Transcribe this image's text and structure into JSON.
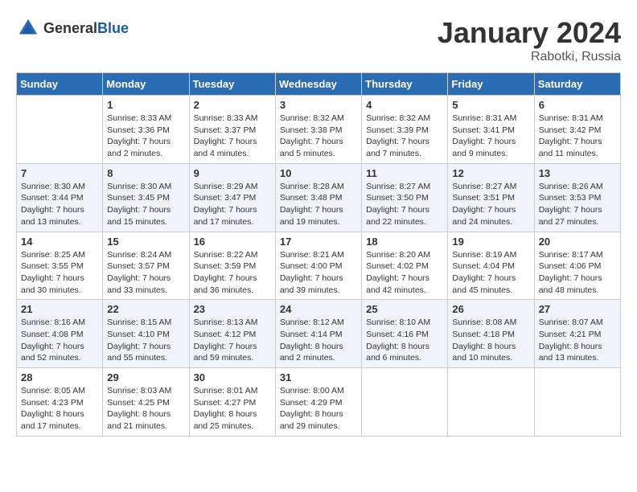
{
  "header": {
    "logo_general": "General",
    "logo_blue": "Blue",
    "month": "January 2024",
    "location": "Rabotki, Russia"
  },
  "columns": [
    "Sunday",
    "Monday",
    "Tuesday",
    "Wednesday",
    "Thursday",
    "Friday",
    "Saturday"
  ],
  "weeks": [
    [
      {
        "day": "",
        "info": ""
      },
      {
        "day": "1",
        "info": "Sunrise: 8:33 AM\nSunset: 3:36 PM\nDaylight: 7 hours\nand 2 minutes."
      },
      {
        "day": "2",
        "info": "Sunrise: 8:33 AM\nSunset: 3:37 PM\nDaylight: 7 hours\nand 4 minutes."
      },
      {
        "day": "3",
        "info": "Sunrise: 8:32 AM\nSunset: 3:38 PM\nDaylight: 7 hours\nand 5 minutes."
      },
      {
        "day": "4",
        "info": "Sunrise: 8:32 AM\nSunset: 3:39 PM\nDaylight: 7 hours\nand 7 minutes."
      },
      {
        "day": "5",
        "info": "Sunrise: 8:31 AM\nSunset: 3:41 PM\nDaylight: 7 hours\nand 9 minutes."
      },
      {
        "day": "6",
        "info": "Sunrise: 8:31 AM\nSunset: 3:42 PM\nDaylight: 7 hours\nand 11 minutes."
      }
    ],
    [
      {
        "day": "7",
        "info": "Sunrise: 8:30 AM\nSunset: 3:44 PM\nDaylight: 7 hours\nand 13 minutes."
      },
      {
        "day": "8",
        "info": "Sunrise: 8:30 AM\nSunset: 3:45 PM\nDaylight: 7 hours\nand 15 minutes."
      },
      {
        "day": "9",
        "info": "Sunrise: 8:29 AM\nSunset: 3:47 PM\nDaylight: 7 hours\nand 17 minutes."
      },
      {
        "day": "10",
        "info": "Sunrise: 8:28 AM\nSunset: 3:48 PM\nDaylight: 7 hours\nand 19 minutes."
      },
      {
        "day": "11",
        "info": "Sunrise: 8:27 AM\nSunset: 3:50 PM\nDaylight: 7 hours\nand 22 minutes."
      },
      {
        "day": "12",
        "info": "Sunrise: 8:27 AM\nSunset: 3:51 PM\nDaylight: 7 hours\nand 24 minutes."
      },
      {
        "day": "13",
        "info": "Sunrise: 8:26 AM\nSunset: 3:53 PM\nDaylight: 7 hours\nand 27 minutes."
      }
    ],
    [
      {
        "day": "14",
        "info": "Sunrise: 8:25 AM\nSunset: 3:55 PM\nDaylight: 7 hours\nand 30 minutes."
      },
      {
        "day": "15",
        "info": "Sunrise: 8:24 AM\nSunset: 3:57 PM\nDaylight: 7 hours\nand 33 minutes."
      },
      {
        "day": "16",
        "info": "Sunrise: 8:22 AM\nSunset: 3:59 PM\nDaylight: 7 hours\nand 36 minutes."
      },
      {
        "day": "17",
        "info": "Sunrise: 8:21 AM\nSunset: 4:00 PM\nDaylight: 7 hours\nand 39 minutes."
      },
      {
        "day": "18",
        "info": "Sunrise: 8:20 AM\nSunset: 4:02 PM\nDaylight: 7 hours\nand 42 minutes."
      },
      {
        "day": "19",
        "info": "Sunrise: 8:19 AM\nSunset: 4:04 PM\nDaylight: 7 hours\nand 45 minutes."
      },
      {
        "day": "20",
        "info": "Sunrise: 8:17 AM\nSunset: 4:06 PM\nDaylight: 7 hours\nand 48 minutes."
      }
    ],
    [
      {
        "day": "21",
        "info": "Sunrise: 8:16 AM\nSunset: 4:08 PM\nDaylight: 7 hours\nand 52 minutes."
      },
      {
        "day": "22",
        "info": "Sunrise: 8:15 AM\nSunset: 4:10 PM\nDaylight: 7 hours\nand 55 minutes."
      },
      {
        "day": "23",
        "info": "Sunrise: 8:13 AM\nSunset: 4:12 PM\nDaylight: 7 hours\nand 59 minutes."
      },
      {
        "day": "24",
        "info": "Sunrise: 8:12 AM\nSunset: 4:14 PM\nDaylight: 8 hours\nand 2 minutes."
      },
      {
        "day": "25",
        "info": "Sunrise: 8:10 AM\nSunset: 4:16 PM\nDaylight: 8 hours\nand 6 minutes."
      },
      {
        "day": "26",
        "info": "Sunrise: 8:08 AM\nSunset: 4:18 PM\nDaylight: 8 hours\nand 10 minutes."
      },
      {
        "day": "27",
        "info": "Sunrise: 8:07 AM\nSunset: 4:21 PM\nDaylight: 8 hours\nand 13 minutes."
      }
    ],
    [
      {
        "day": "28",
        "info": "Sunrise: 8:05 AM\nSunset: 4:23 PM\nDaylight: 8 hours\nand 17 minutes."
      },
      {
        "day": "29",
        "info": "Sunrise: 8:03 AM\nSunset: 4:25 PM\nDaylight: 8 hours\nand 21 minutes."
      },
      {
        "day": "30",
        "info": "Sunrise: 8:01 AM\nSunset: 4:27 PM\nDaylight: 8 hours\nand 25 minutes."
      },
      {
        "day": "31",
        "info": "Sunrise: 8:00 AM\nSunset: 4:29 PM\nDaylight: 8 hours\nand 29 minutes."
      },
      {
        "day": "",
        "info": ""
      },
      {
        "day": "",
        "info": ""
      },
      {
        "day": "",
        "info": ""
      }
    ]
  ]
}
